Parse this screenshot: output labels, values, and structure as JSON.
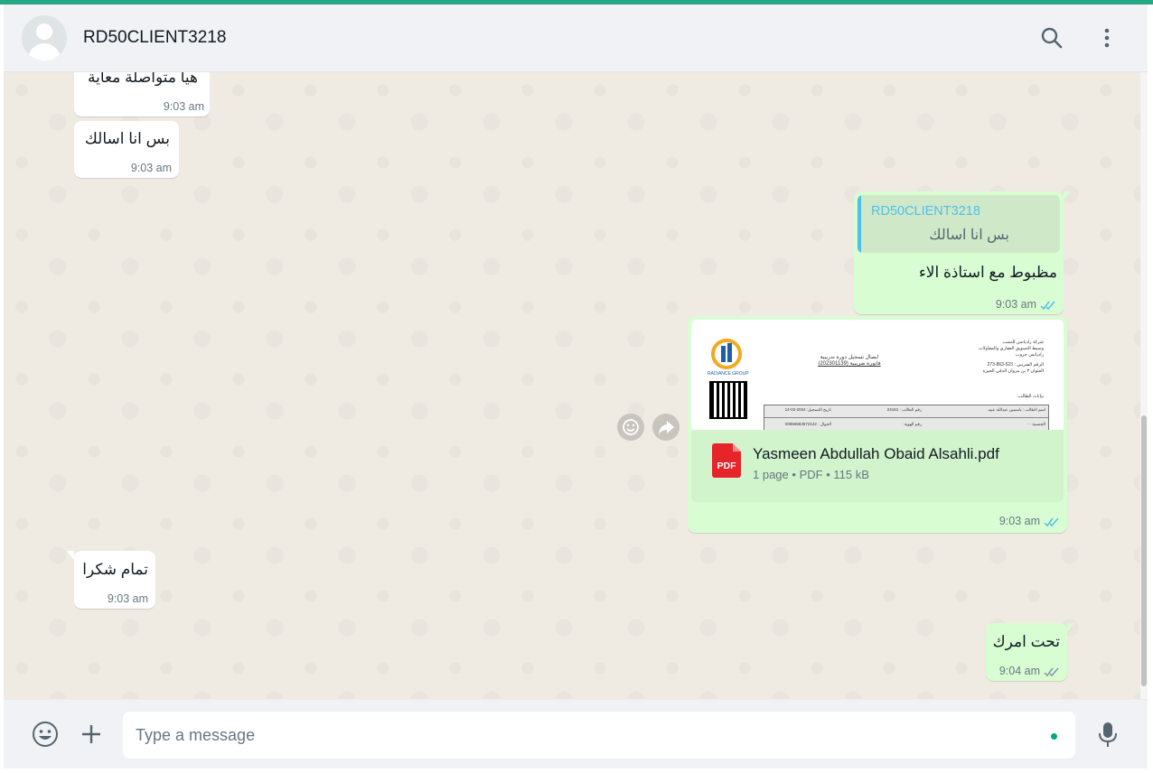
{
  "header": {
    "contact_name": "RD50CLIENT3218"
  },
  "messages": [
    {
      "dir": "in",
      "text": "هيا متواصلة معاية",
      "time": "9:03 am"
    },
    {
      "dir": "in",
      "text": "بس انا اسالك",
      "time": "9:03 am"
    },
    {
      "dir": "out",
      "quote": {
        "author": "RD50CLIENT3218",
        "text": "بس انا اسالك"
      },
      "text": "مظبوط مع استاذة الاء",
      "time": "9:03 am",
      "status": "read"
    },
    {
      "dir": "out",
      "document": {
        "file_name": "Yasmeen Abdullah Obaid Alsahli.pdf",
        "pages": "1 page",
        "type": "PDF",
        "size": "115 kB",
        "badge": "PDF"
      },
      "time": "9:03 am",
      "status": "read"
    },
    {
      "dir": "in",
      "text": "تمام شكرا",
      "time": "9:03 am"
    },
    {
      "dir": "out",
      "text": "تحت امرك",
      "time": "9:04 am",
      "status": "delivered"
    }
  ],
  "preview": {
    "company_lines": [
      "شركة راديانس للنسب",
      "وسيط التسويق العقاري والمقاولات",
      "راديانس جروب"
    ],
    "tax_number": "الرقم الضريبي : 523-863-273",
    "address": "العنوان ٣ بن مروان الدقي الجيزة",
    "invoice_title": "ايصال تسجيل دورة تدريبية",
    "invoice_number": "فاتورة ضريبية (202301139)",
    "section_label": "بيانات الطالب:",
    "student_label": "اسم الطالب : ياسمين عبدالله عبيد",
    "student_no": "رقم الطالب : 24161",
    "reg_date": "تاريخ التسجيل: 2024-02-14",
    "nationality": "الجنسية : -",
    "id_label": "رقم الهوية :",
    "phone": "الجوال : 00966563572122",
    "logo_text": "RADIANCE GROUP"
  },
  "composer": {
    "placeholder": "Type a message"
  },
  "icons": {
    "search": "search-icon",
    "menu": "menu-icon",
    "emoji": "emoji-icon",
    "attach": "plus-icon",
    "mic": "mic-icon",
    "forward": "forward-icon",
    "react": "emoji-reaction-icon"
  },
  "colors": {
    "accent": "#25a884",
    "outgoing": "#d9fdd3",
    "incoming": "#ffffff",
    "read_ticks": "#53bdeb",
    "pdf": "#e5252a"
  }
}
